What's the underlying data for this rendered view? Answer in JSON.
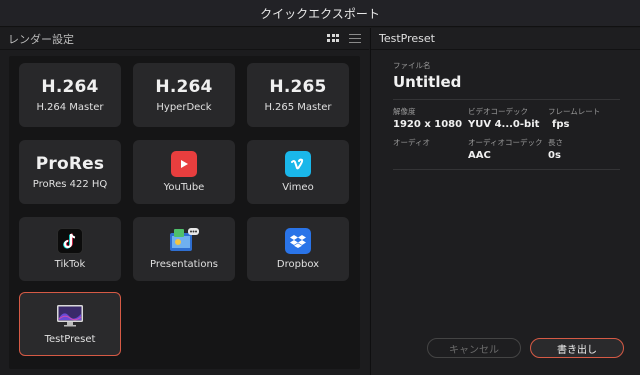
{
  "window": {
    "title": "クイックエクスポート"
  },
  "left_panel": {
    "title": "レンダー設定",
    "view_icons": [
      "grid-view-icon",
      "list-view-icon"
    ]
  },
  "presets": [
    {
      "codec": "H.264",
      "label": "H.264 Master"
    },
    {
      "codec": "H.264",
      "label": "HyperDeck"
    },
    {
      "codec": "H.265",
      "label": "H.265 Master"
    },
    {
      "codec": "ProRes",
      "label": "ProRes 422 HQ"
    },
    {
      "icon": "youtube-icon",
      "label": "YouTube"
    },
    {
      "icon": "vimeo-icon",
      "label": "Vimeo"
    },
    {
      "icon": "tiktok-icon",
      "label": "TikTok"
    },
    {
      "icon": "presentations-icon",
      "label": "Presentations"
    },
    {
      "icon": "dropbox-icon",
      "label": "Dropbox"
    },
    {
      "icon": "monitor-icon",
      "label": "TestPreset",
      "selected": true
    }
  ],
  "right_panel": {
    "title": "TestPreset",
    "filename_label": "ファイル名",
    "filename": "Untitled",
    "fields": {
      "resolution_label": "解像度",
      "resolution": "1920 x 1080",
      "video_codec_label": "ビデオコーデック",
      "video_codec": "YUV 4...0-bit",
      "frame_rate_label": "フレームレート",
      "frame_rate": "fps",
      "audio_label": "オーディオ",
      "audio_codec_label": "オーディオコーデック",
      "audio_codec": "AAC",
      "length_label": "長さ",
      "length": "0s"
    },
    "buttons": {
      "cancel": "キャンセル",
      "export": "書き出し"
    }
  },
  "colors": {
    "accent": "#d65a45",
    "youtube": "#e83e3e",
    "vimeo": "#1ab7ea",
    "dropbox": "#2a74e8"
  }
}
